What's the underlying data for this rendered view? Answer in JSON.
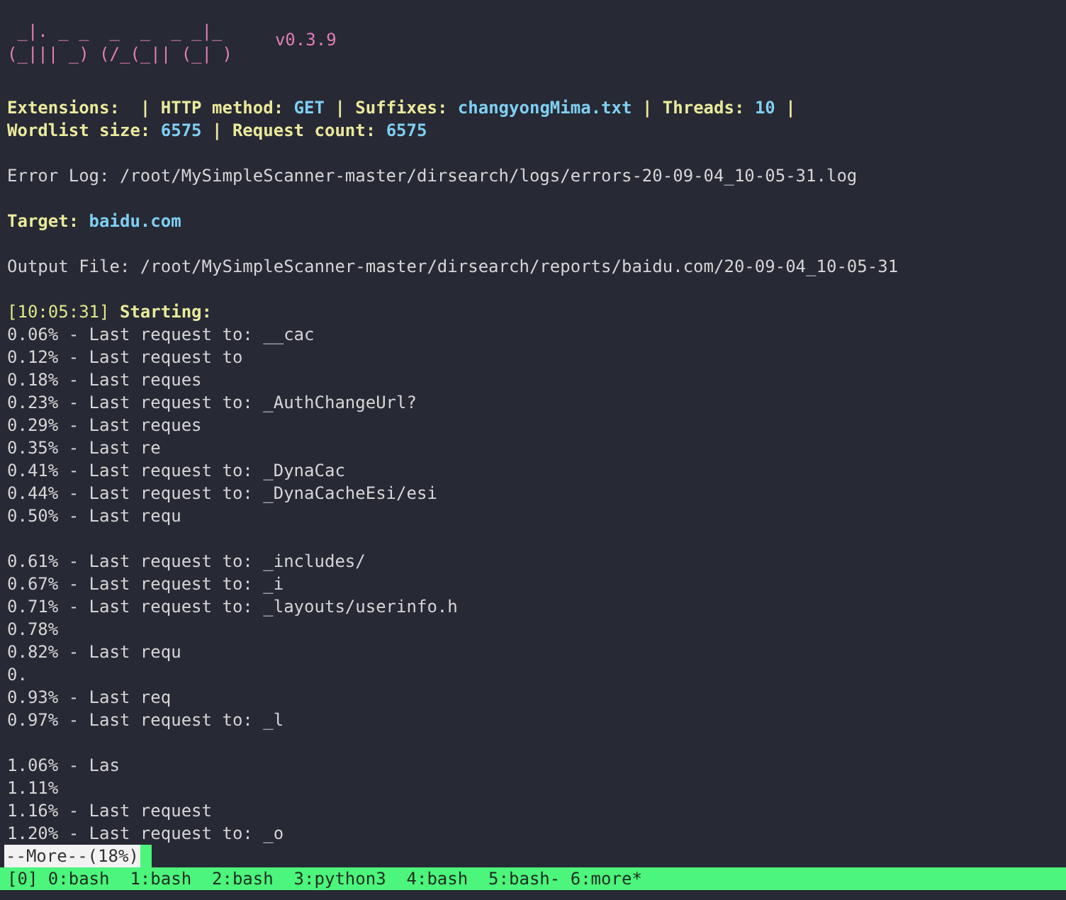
{
  "banner": {
    "art": [
      " _|. _ _  _  _  _ _|_",
      "(_||| _) (/_(_|| (_| )"
    ],
    "version": "v0.3.9"
  },
  "info": [
    {
      "kind": "line",
      "segments": [
        {
          "kind": "label",
          "text": "Extensions: "
        },
        {
          "kind": "label",
          "text": " | HTTP method: "
        },
        {
          "kind": "value",
          "text": "GET"
        },
        {
          "kind": "label",
          "text": " | Suffixes: "
        },
        {
          "kind": "value",
          "text": "changyongMima.txt"
        },
        {
          "kind": "label",
          "text": " | Threads: "
        },
        {
          "kind": "value",
          "text": "10"
        },
        {
          "kind": "label",
          "text": " |"
        }
      ]
    },
    {
      "kind": "line",
      "segments": [
        {
          "kind": "label",
          "text": "Wordlist size: "
        },
        {
          "kind": "value",
          "text": "6575"
        },
        {
          "kind": "label",
          "text": " | Request count: "
        },
        {
          "kind": "value",
          "text": "6575"
        }
      ]
    },
    {
      "kind": "blank"
    },
    {
      "kind": "line",
      "segments": [
        {
          "kind": "plain",
          "text": "Error Log: /root/MySimpleScanner-master/dirsearch/logs/errors-20-09-04_10-05-31.log"
        }
      ]
    },
    {
      "kind": "blank"
    },
    {
      "kind": "line",
      "segments": [
        {
          "kind": "label",
          "text": "Target: "
        },
        {
          "kind": "value",
          "text": "baidu.com"
        }
      ]
    },
    {
      "kind": "blank"
    },
    {
      "kind": "line",
      "segments": [
        {
          "kind": "plain",
          "text": "Output File: /root/MySimpleScanner-master/dirsearch/reports/baidu.com/20-09-04_10-05-31"
        }
      ]
    },
    {
      "kind": "blank"
    },
    {
      "kind": "line",
      "segments": [
        {
          "kind": "time",
          "text": "[10:05:31]"
        },
        {
          "kind": "label",
          "text": " Starting:"
        }
      ]
    }
  ],
  "progress": [
    {
      "kind": "line",
      "text": "0.06% - Last request to: __cac"
    },
    {
      "kind": "line",
      "text": "0.12% - Last request to"
    },
    {
      "kind": "line",
      "text": "0.18% - Last reques"
    },
    {
      "kind": "line",
      "text": "0.23% - Last request to: _AuthChangeUrl?"
    },
    {
      "kind": "line",
      "text": "0.29% - Last reques"
    },
    {
      "kind": "line",
      "text": "0.35% - Last re"
    },
    {
      "kind": "line",
      "text": "0.41% - Last request to: _DynaCac"
    },
    {
      "kind": "line",
      "text": "0.44% - Last request to: _DynaCacheEsi/esi"
    },
    {
      "kind": "line",
      "text": "0.50% - Last requ"
    },
    {
      "kind": "blank"
    },
    {
      "kind": "line",
      "text": "0.61% - Last request to: _includes/"
    },
    {
      "kind": "line",
      "text": "0.67% - Last request to: _i"
    },
    {
      "kind": "line",
      "text": "0.71% - Last request to: _layouts/userinfo.h"
    },
    {
      "kind": "line",
      "text": "0.78%"
    },
    {
      "kind": "line",
      "text": "0.82% - Last requ"
    },
    {
      "kind": "line",
      "text": "0."
    },
    {
      "kind": "line",
      "text": "0.93% - Last req"
    },
    {
      "kind": "line",
      "text": "0.97% - Last request to: _l"
    },
    {
      "kind": "blank"
    },
    {
      "kind": "line",
      "text": "1.06% - Las"
    },
    {
      "kind": "line",
      "text": "1.11%"
    },
    {
      "kind": "line",
      "text": "1.16% - Last request"
    },
    {
      "kind": "line",
      "text": "1.20% - Last request to: _o"
    }
  ],
  "pager": {
    "prompt": "--More--(18%)"
  },
  "status_bar": {
    "text": "[0] 0:bash  1:bash  2:bash  3:python3  4:bash  5:bash- 6:more*"
  }
}
